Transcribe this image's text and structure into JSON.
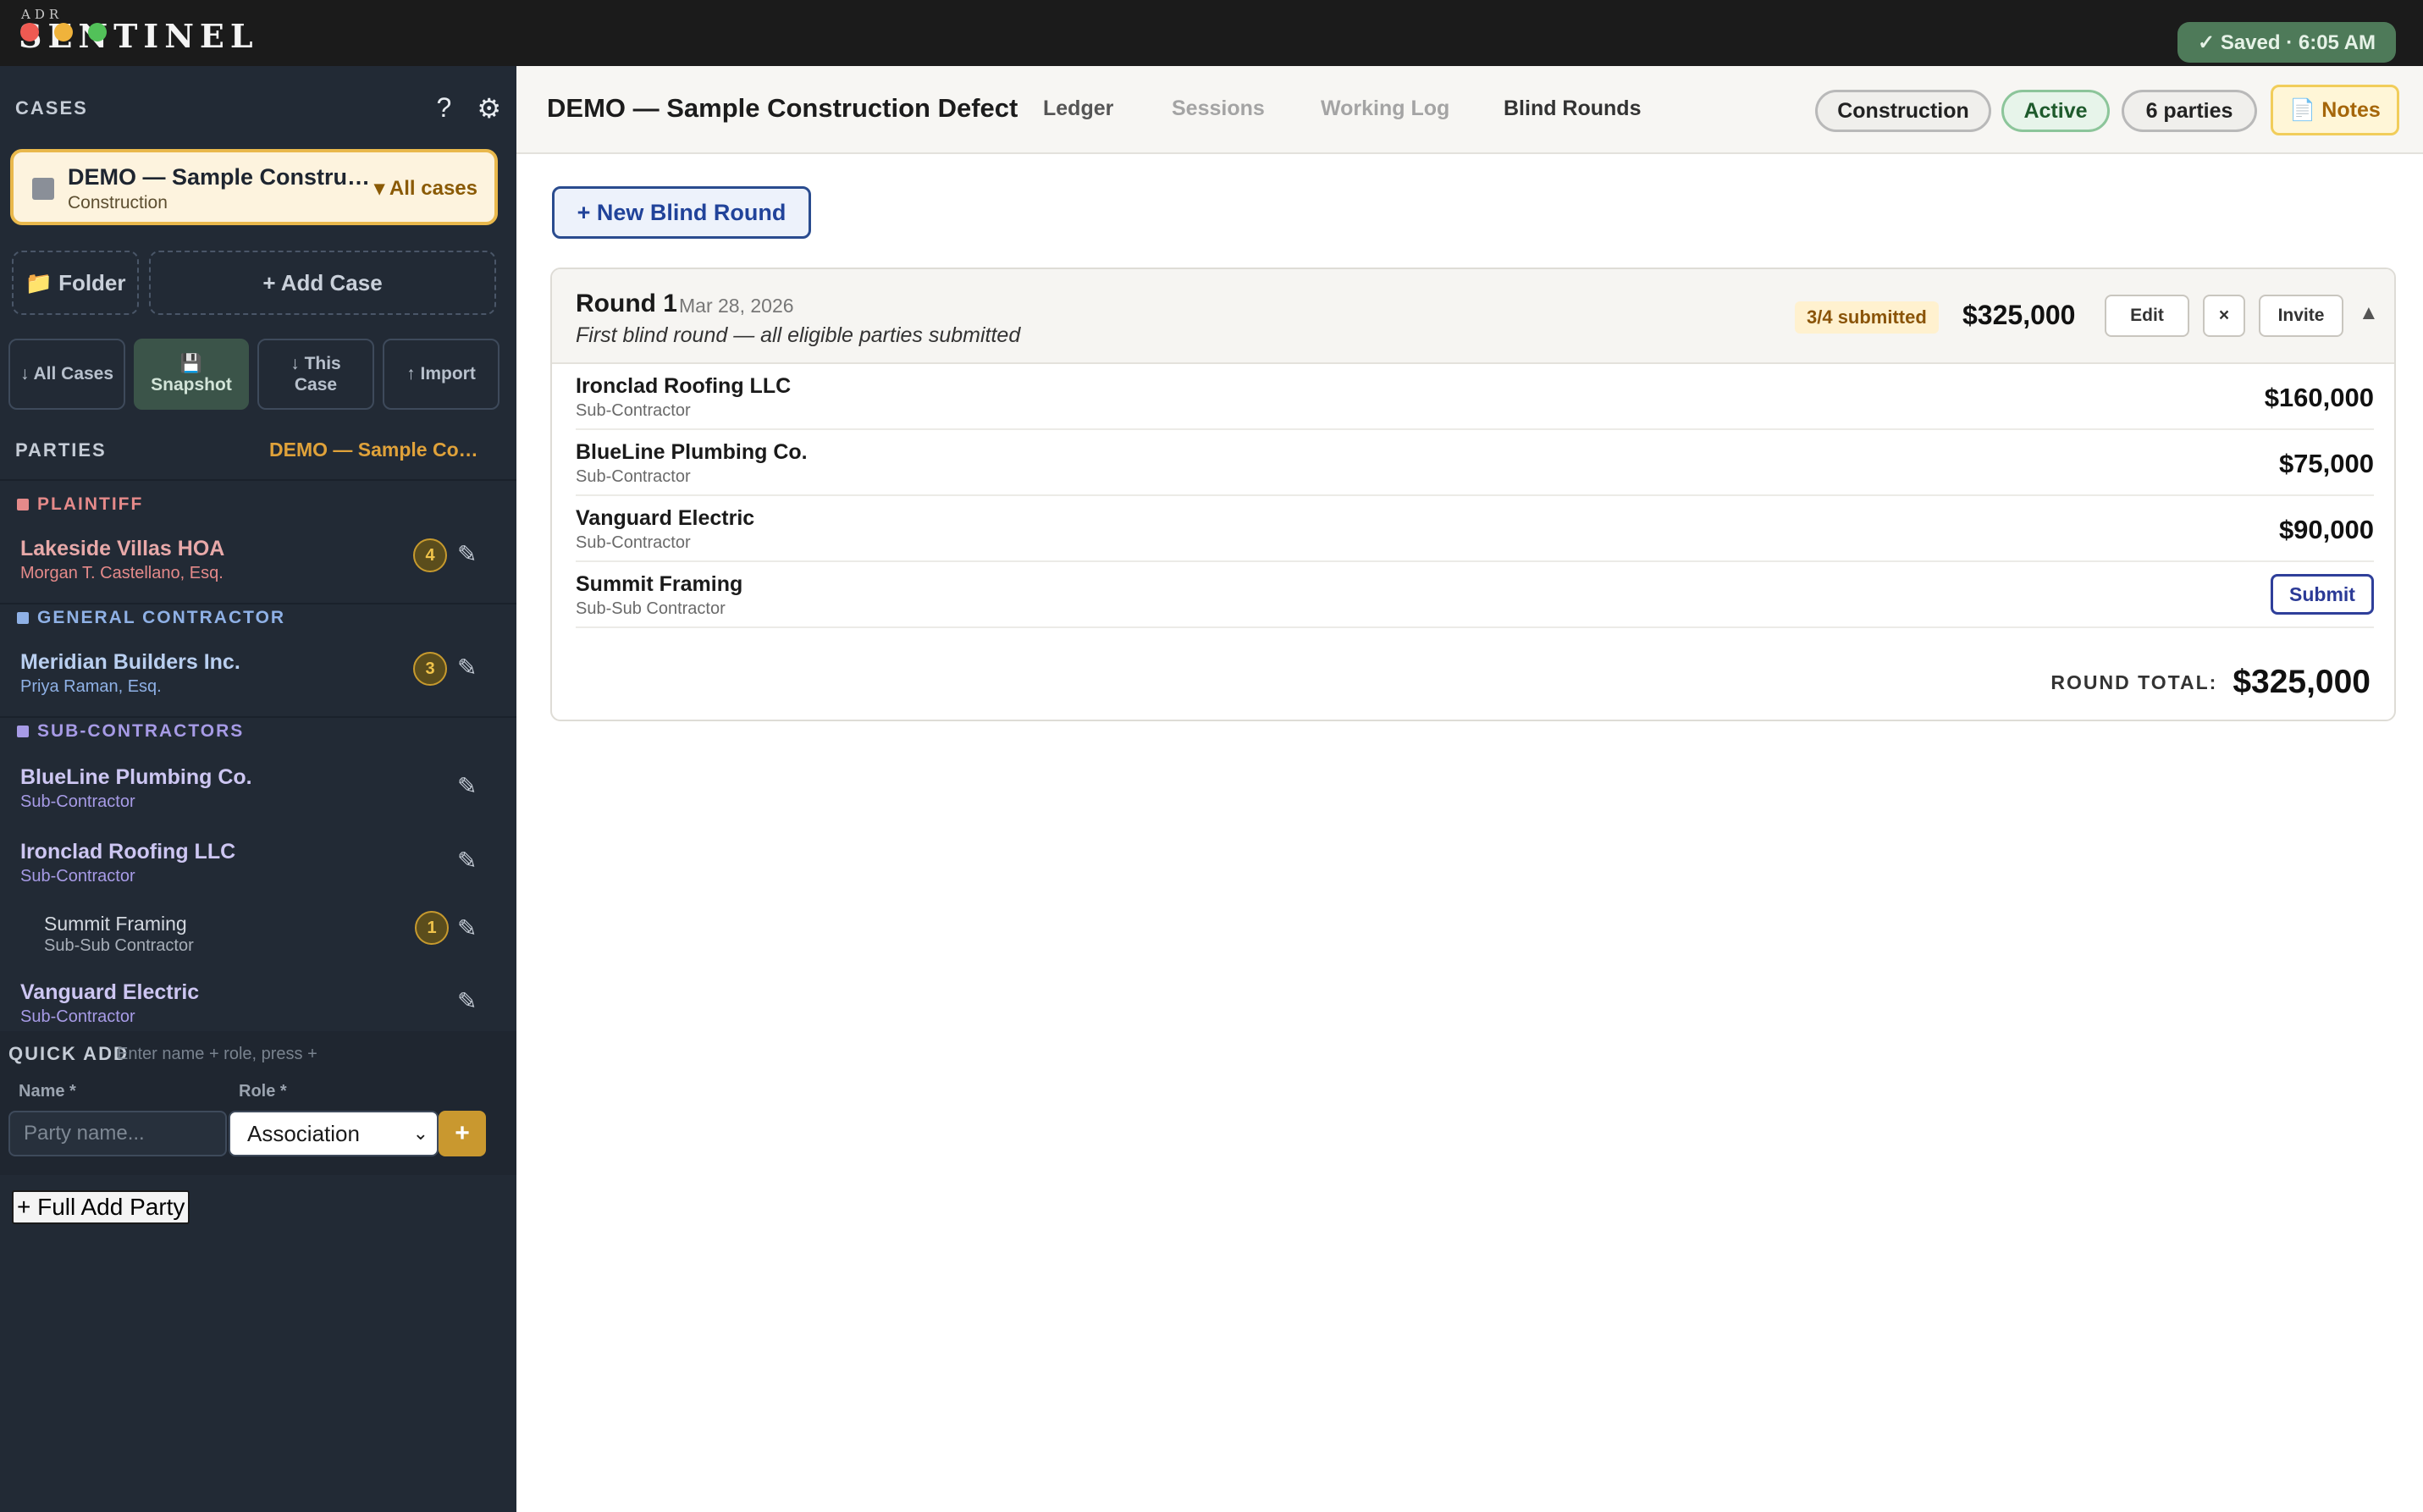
{
  "brand": {
    "small": "ADR",
    "large": "SENTINEL"
  },
  "status": {
    "saved": "✓ Saved · 6:05 AM"
  },
  "sidebar": {
    "title": "CASES",
    "help_icon": "?",
    "settings_icon": "⚙",
    "current_case": {
      "name": "DEMO — Sample Construction Defect",
      "type": "Construction",
      "switch_label": "▾ All cases"
    },
    "folder_label": "📁 Folder",
    "add_case_label": "+ Add Case",
    "export_buttons": [
      {
        "label": "↓ All Cases"
      },
      {
        "label": "💾\nSnapshot"
      },
      {
        "label": "↓ This\nCase"
      },
      {
        "label": "↑ Import"
      }
    ],
    "parties_title": "PARTIES",
    "parties_case": "DEMO — Sample Construction Defect",
    "groups": [
      {
        "label": "PLAINTIFF",
        "color": "#e58a8a"
      },
      {
        "label": "GENERAL CONTRACTOR",
        "color": "#8fb1e6"
      },
      {
        "label": "SUB-CONTRACTORS",
        "color": "#a79be6"
      }
    ],
    "parties": [
      {
        "name": "Lakeside Villas HOA",
        "sub": "Morgan T. Castellano, Esq.",
        "badge": "4",
        "name_color": "#e8a9a9",
        "sub_color": "#e58a8a"
      },
      {
        "name": "Meridian Builders Inc.",
        "sub": "Priya Raman, Esq.",
        "badge": "3",
        "name_color": "#b9cff0",
        "sub_color": "#8fb1e6"
      },
      {
        "name": "BlueLine Plumbing Co.",
        "sub": "Sub-Contractor",
        "badge": "",
        "name_color": "#cdc6f2",
        "sub_color": "#a79be6"
      },
      {
        "name": "Ironclad Roofing LLC",
        "sub": "Sub-Contractor",
        "badge": "",
        "name_color": "#cdc6f2",
        "sub_color": "#a79be6"
      },
      {
        "name": "Summit Framing",
        "sub": "Sub-Sub Contractor",
        "badge": "1",
        "name_color": "#c9cfd8",
        "sub_color": "#a7aeb8"
      },
      {
        "name": "Vanguard Electric",
        "sub": "Sub-Contractor",
        "badge": "",
        "name_color": "#cdc6f2",
        "sub_color": "#a79be6"
      }
    ],
    "edit_icon": "✎",
    "quick_add": {
      "title": "QUICK ADD",
      "hint": "Enter name + role, press +",
      "name_label": "Name *",
      "role_label": "Role *",
      "name_placeholder": "Party name...",
      "role_value": "Association",
      "plus": "+",
      "full_add_label": "+ Full Add Party"
    }
  },
  "header": {
    "case_title": "DEMO — Sample Construction Defect",
    "tabs": [
      "Ledger",
      "Sessions",
      "Working Log",
      "Blind Rounds"
    ],
    "pills": {
      "type": "Construction",
      "status": "Active",
      "parties": "6 parties",
      "notes": "📄 Notes"
    }
  },
  "main": {
    "new_round_label": "+ New Blind Round",
    "round": {
      "title": "Round 1",
      "date": "Mar 28, 2026",
      "description": "First blind round — all eligible parties submitted",
      "submitted": "3/4 submitted",
      "total_head": "$325,000",
      "edit_label": "Edit",
      "close_label": "×",
      "invite_label": "Invite",
      "collapse_icon": "▲",
      "rows": [
        {
          "name": "Ironclad Roofing LLC",
          "role": "Sub-Contractor",
          "amount": "$160,000"
        },
        {
          "name": "BlueLine Plumbing Co.",
          "role": "Sub-Contractor",
          "amount": "$75,000"
        },
        {
          "name": "Vanguard Electric",
          "role": "Sub-Contractor",
          "amount": "$90,000"
        },
        {
          "name": "Summit Framing",
          "role": "Sub-Sub Contractor",
          "action": "Submit"
        }
      ],
      "total_label": "ROUND TOTAL:",
      "total_value": "$325,000"
    }
  }
}
